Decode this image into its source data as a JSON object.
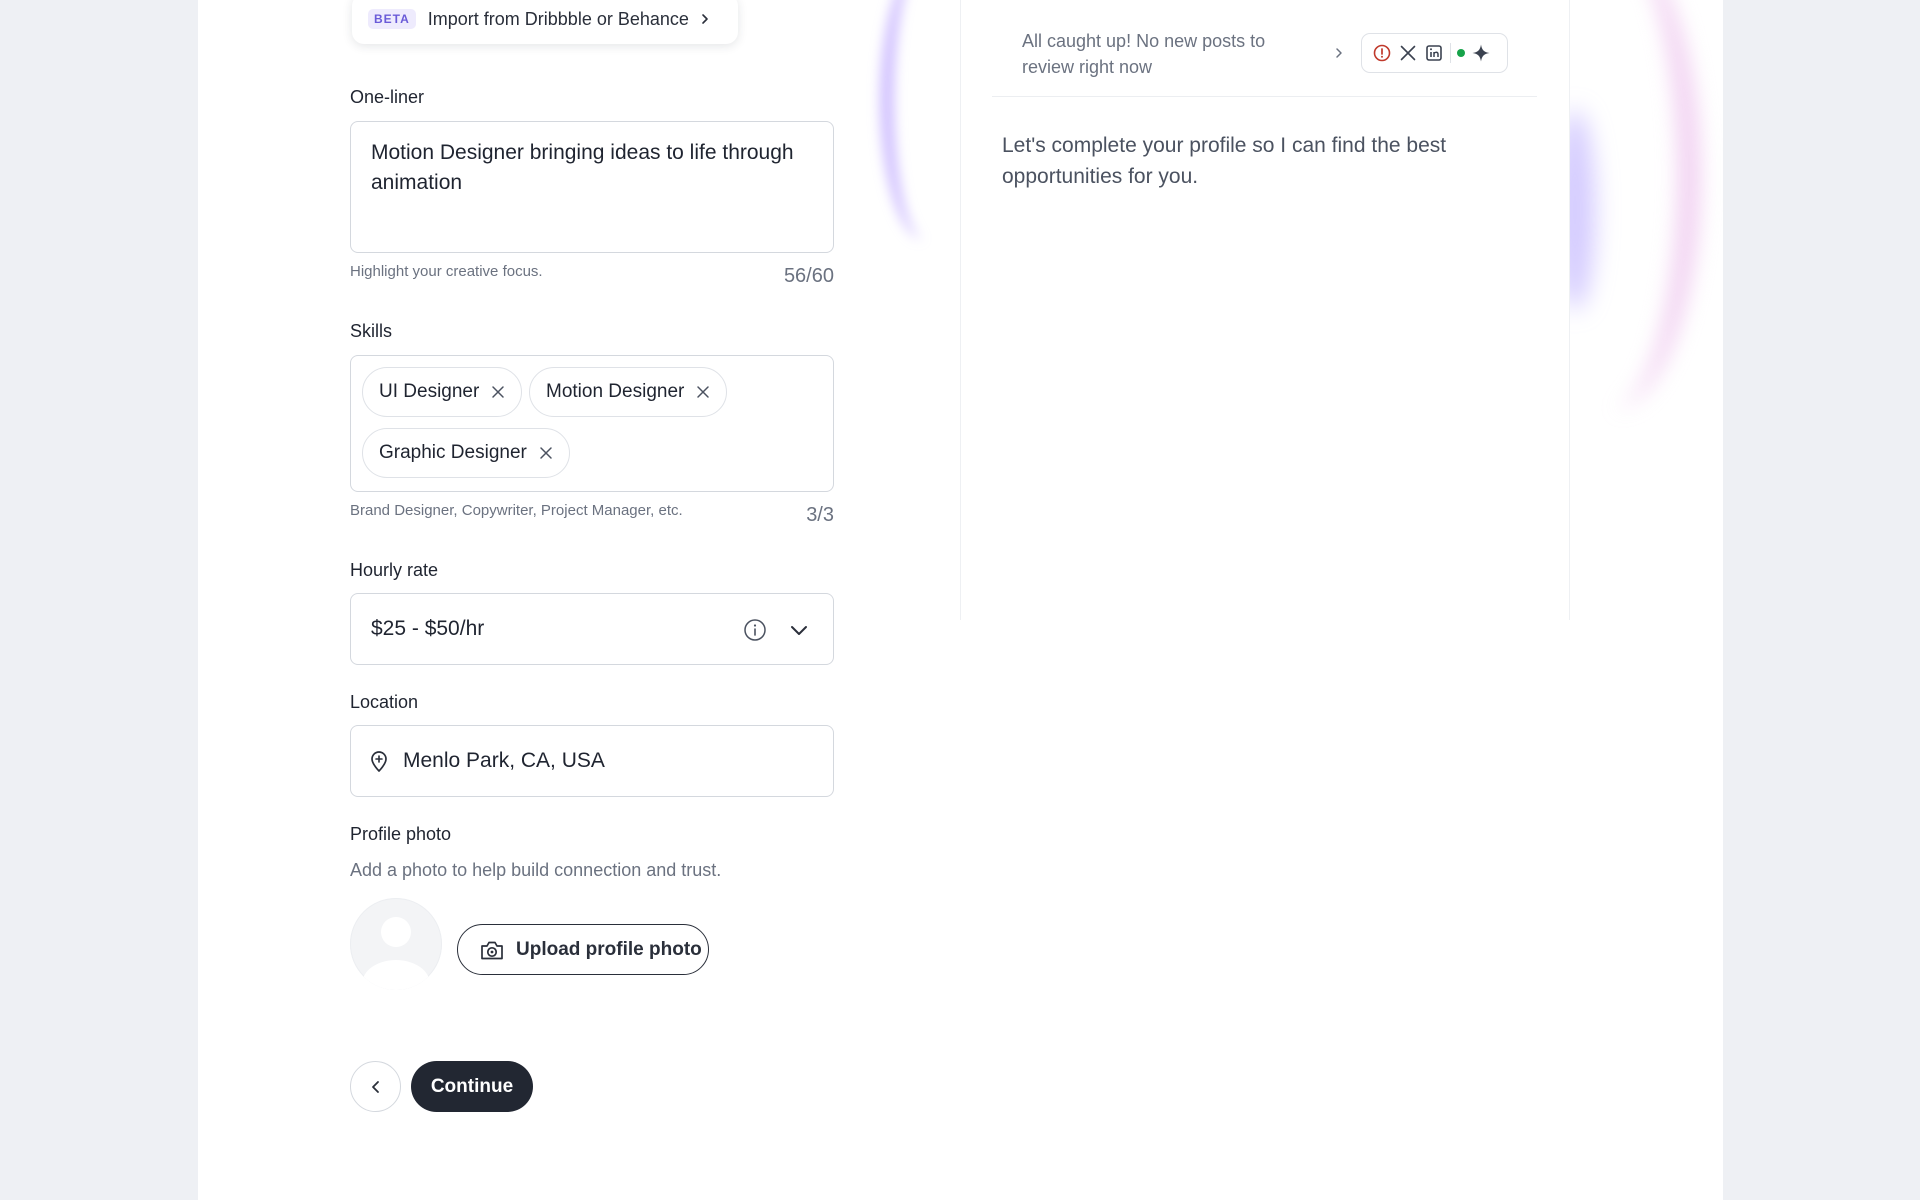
{
  "import": {
    "badge": "BETA",
    "label": "Import from Dribbble or Behance"
  },
  "one_liner": {
    "label": "One-liner",
    "value": "Motion Designer bringing ideas to life through animation",
    "hint": "Highlight your creative focus.",
    "counter": "56/60"
  },
  "skills": {
    "label": "Skills",
    "items": [
      "UI Designer",
      "Motion Designer",
      "Graphic Designer"
    ],
    "hint": "Brand Designer, Copywriter, Project Manager, etc.",
    "counter": "3/3"
  },
  "hourly_rate": {
    "label": "Hourly rate",
    "value": "$25 - $50/hr"
  },
  "location": {
    "label": "Location",
    "value": "Menlo Park, CA, USA"
  },
  "profile_photo": {
    "label": "Profile photo",
    "hint": "Add a photo to help build connection and trust.",
    "upload_label": "Upload profile photo"
  },
  "actions": {
    "continue_label": "Continue"
  },
  "panel": {
    "status": "All caught up! No new posts to review right now",
    "message": "Let's complete your profile so I can find the best opportunities for you.",
    "icons": [
      "alert-circle-icon",
      "x-logo-icon",
      "linkedin-icon",
      "status-dot",
      "sparkle-icon"
    ]
  },
  "colors": {
    "accent": "#6a5bd8",
    "primary_button": "#222732",
    "status_green": "#16a34a",
    "alert_red": "#c0392b"
  }
}
